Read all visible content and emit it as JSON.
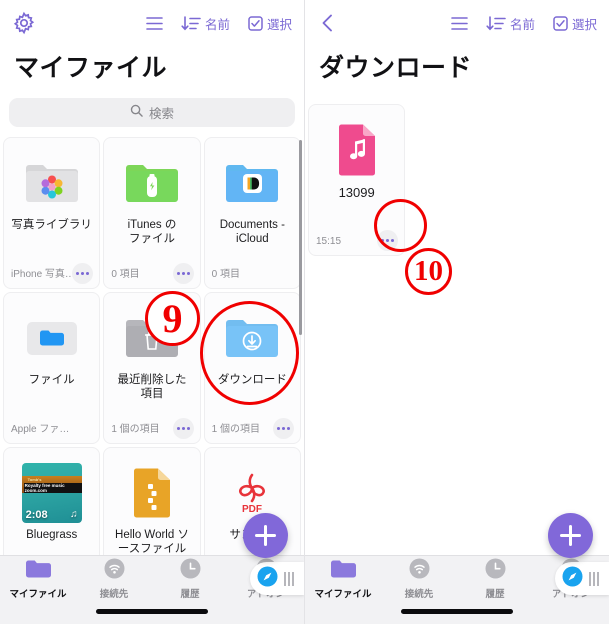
{
  "left_panel": {
    "topbar": {
      "settings_icon": "gear-icon",
      "list_icon": "list-view-icon",
      "sort": {
        "icon": "sort-descending-icon",
        "label": "名前"
      },
      "select": {
        "icon": "checkbox-icon",
        "label": "選択"
      }
    },
    "title": "マイファイル",
    "search": {
      "icon": "search-icon",
      "placeholder": "検索"
    },
    "items": [
      {
        "name": "写真ライブラリ",
        "meta": "iPhone 写真ラ…",
        "icon": "photos-folder-icon",
        "has_menu": true
      },
      {
        "name": "iTunes の\nファイル",
        "meta": "0 項目",
        "icon": "itunes-folder-icon",
        "has_menu": true
      },
      {
        "name": "Documents -\niCloud",
        "meta": "0 項目",
        "icon": "documents-folder-icon",
        "has_menu": false
      },
      {
        "name": "ファイル",
        "meta": "Apple ファイル",
        "icon": "files-folder-icon",
        "has_menu": false
      },
      {
        "name": "最近削除した\n項目",
        "meta": "1 個の項目",
        "icon": "trash-folder-icon",
        "has_menu": true
      },
      {
        "name": "ダウンロード",
        "meta": "1 個の項目",
        "icon": "download-folder-icon",
        "has_menu": true
      },
      {
        "name": "Bluegrass",
        "meta": "",
        "icon": "audio-thumbnail",
        "duration": "2:08",
        "has_menu": false
      },
      {
        "name": "Hello World ソ\nースファイル",
        "meta": "",
        "icon": "code-file-icon",
        "has_menu": false
      },
      {
        "name": "サンプル",
        "meta": "",
        "icon": "pdf-file-icon",
        "pdf_label": "PDF",
        "has_menu": false
      }
    ],
    "fab_label": "+",
    "tabs": [
      {
        "label": "マイファイル",
        "icon": "folder-icon",
        "active": true
      },
      {
        "label": "接続先",
        "icon": "wifi-icon",
        "active": false
      },
      {
        "label": "履歴",
        "icon": "clock-icon",
        "active": false
      },
      {
        "label": "アドオン",
        "icon": "cart-icon",
        "active": false
      }
    ],
    "annotation": {
      "number": "9"
    }
  },
  "right_panel": {
    "topbar": {
      "back_icon": "back-chevron-icon",
      "list_icon": "list-view-icon",
      "sort": {
        "icon": "sort-descending-icon",
        "label": "名前"
      },
      "select": {
        "icon": "checkbox-icon",
        "label": "選択"
      }
    },
    "title": "ダウンロード",
    "items": [
      {
        "name": "13099",
        "meta": "15:15",
        "icon": "music-file-icon",
        "has_menu": true
      }
    ],
    "fab_label": "+",
    "tabs": [
      {
        "label": "マイファイル",
        "icon": "folder-icon",
        "active": true
      },
      {
        "label": "接続先",
        "icon": "wifi-icon",
        "active": false
      },
      {
        "label": "履歴",
        "icon": "clock-icon",
        "active": false
      },
      {
        "label": "アドオン",
        "icon": "cart-icon",
        "active": false
      }
    ],
    "annotation": {
      "number": "10"
    }
  },
  "colors": {
    "accent_purple": "#7b69d4",
    "fab_purple": "#8168d9",
    "annotation_red": "#f00000",
    "music_pink": "#ef4b8e"
  }
}
